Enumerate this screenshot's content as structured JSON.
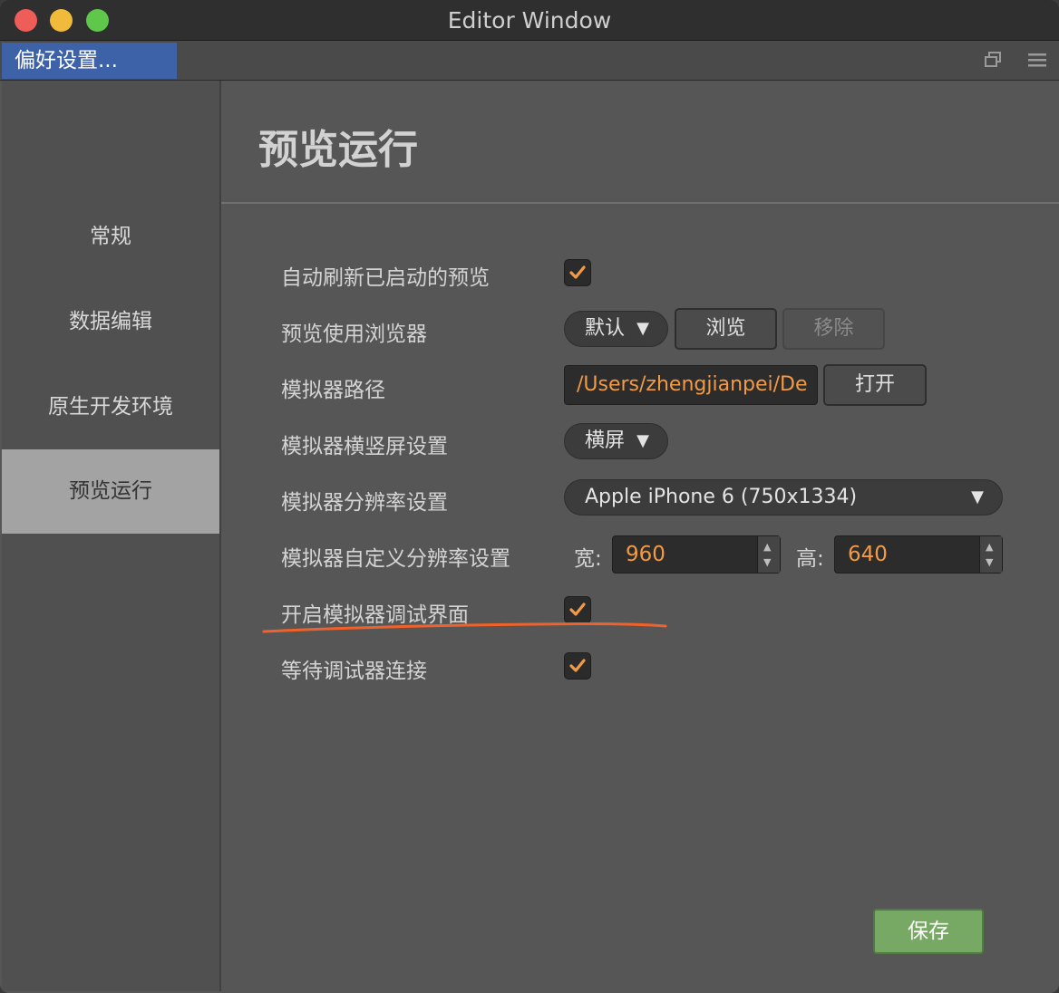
{
  "window": {
    "title": "Editor Window"
  },
  "tabs": {
    "active_label": "偏好设置..."
  },
  "sidebar": {
    "items": [
      {
        "label": "常规"
      },
      {
        "label": "数据编辑"
      },
      {
        "label": "原生开发环境"
      },
      {
        "label": "预览运行",
        "active": true
      }
    ]
  },
  "main": {
    "title": "预览运行",
    "settings": {
      "auto_refresh": {
        "label": "自动刷新已启动的预览",
        "checked": true
      },
      "browser": {
        "label": "预览使用浏览器",
        "value": "默认",
        "browse_label": "浏览",
        "remove_label": "移除"
      },
      "simulator_path": {
        "label": "模拟器路径",
        "value": "/Users/zhengjianpei/De",
        "open_label": "打开"
      },
      "orientation": {
        "label": "模拟器横竖屏设置",
        "value": "横屏"
      },
      "resolution": {
        "label": "模拟器分辨率设置",
        "value": "Apple iPhone 6 (750x1334)"
      },
      "custom_resolution": {
        "label": "模拟器自定义分辨率设置",
        "width_label": "宽:",
        "width_value": "960",
        "height_label": "高:",
        "height_value": "640"
      },
      "debug_ui": {
        "label": "开启模拟器调试界面",
        "checked": true
      },
      "wait_debugger": {
        "label": "等待调试器连接",
        "checked": true
      }
    },
    "save_label": "保存"
  },
  "icons": {
    "dropdown": "dropdown-arrow-icon",
    "check": "checkmark-icon",
    "window": "restore-window-icon",
    "menu": "hamburger-menu-icon"
  },
  "colors": {
    "accent": "#f39a45",
    "tab_active": "#3d62a8",
    "save_button": "#77a965",
    "annotation": "#f0622b"
  }
}
